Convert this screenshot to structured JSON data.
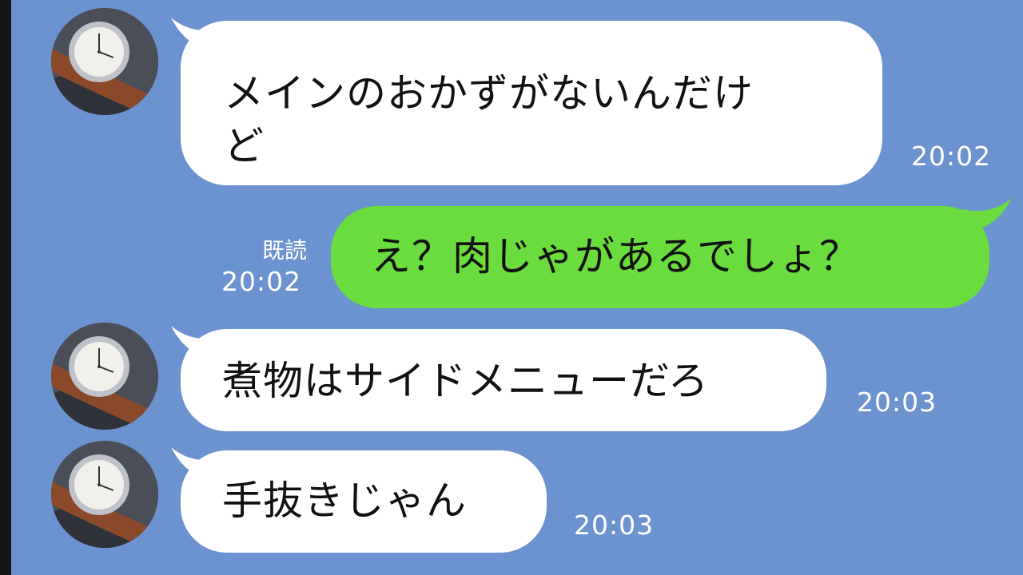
{
  "colors": {
    "background": "#6b93cf",
    "incoming_bubble": "#ffffff",
    "outgoing_bubble": "#6bdc3d",
    "timestamp": "#ffffff"
  },
  "contact": {
    "avatar_icon": "wristwatch-photo-avatar"
  },
  "messages": [
    {
      "direction": "incoming",
      "lines": [
        "メインのおかずがないんだけ",
        "ど"
      ],
      "time": "20:02"
    },
    {
      "direction": "outgoing",
      "text": "え？肉じゃがあるでしょ？",
      "read": "既読",
      "time": "20:02"
    },
    {
      "direction": "incoming",
      "text": "煮物はサイドメニューだろ",
      "time": "20:03"
    },
    {
      "direction": "incoming",
      "text": "手抜きじゃん",
      "time": "20:03"
    }
  ]
}
